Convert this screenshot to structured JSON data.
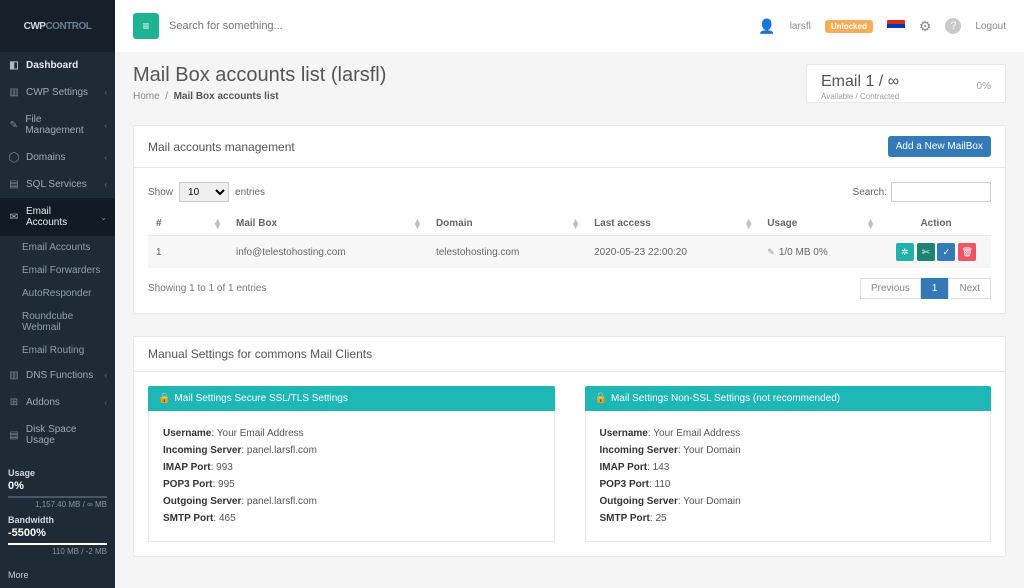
{
  "app": {
    "brand_a": "CWP",
    "brand_b": "CONTROL",
    "search_placeholder": "Search for something...",
    "user_label": "larsfl",
    "unlocked_badge": "Unlocked",
    "logout": "Logout"
  },
  "sidebar": {
    "dashboard": "Dashboard",
    "items": [
      "CWP Settings",
      "File Management",
      "Domains",
      "SQL Services",
      "Email Accounts",
      "DNS Functions",
      "Addons",
      "Disk Space Usage"
    ],
    "email_sub": [
      "Email Accounts",
      "Email Forwarders",
      "AutoResponder",
      "Roundcube Webmail",
      "Email Routing"
    ],
    "stats": {
      "usage_label": "Usage",
      "usage_val": "0%",
      "usage_fine": "1,157.40 MB / ∞ MB",
      "bw_label": "Bandwidth",
      "bw_val": "-5500%",
      "bw_fine": "110 MB / -2 MB"
    },
    "more": "More"
  },
  "page": {
    "title": "Mail Box accounts list (larsfl)",
    "crumb_home": "Home",
    "crumb_curr": "Mail Box accounts list",
    "quota_title": "Email 1 / ∞",
    "quota_sub": "Available / Contracted",
    "quota_pct": "0%"
  },
  "panel": {
    "title": "Mail accounts management",
    "add_btn": "Add a New MailBox",
    "show_label": "Show",
    "entries_label": "entries",
    "search_label": "Search:",
    "info": "Showing 1 to 1 of 1 entries",
    "prev": "Previous",
    "page1": "1",
    "next": "Next"
  },
  "cols": {
    "num": "#",
    "mailbox": "Mail Box",
    "domain": "Domain",
    "last": "Last access",
    "usage": "Usage",
    "action": "Action"
  },
  "rows": {
    "0": {
      "num": "1",
      "mailbox": "info@telestohosting.com",
      "domain": "telestohosting.com",
      "last": "2020-05-23 22:00:20",
      "usage": "1/0 MB 0%"
    }
  },
  "ms": {
    "title": "Manual Settings for commons Mail Clients",
    "secure_h": "Mail Settings Secure SSL/TLS Settings",
    "plain_h": "Mail Settings Non-SSL Settings (not recommended)",
    "ul": "Username",
    "uv": "Your Email Address",
    "isl": "Incoming Server",
    "isv_secure": "panel.larsfl.com",
    "isv_plain": "Your Domain",
    "imapl": "IMAP Port",
    "imapv_secure": "993",
    "imapv_plain": "143",
    "pop3l": "POP3 Port",
    "pop3v_secure": "995",
    "pop3v_plain": "110",
    "osl": "Outgoing Server",
    "osv_secure": "panel.larsfl.com",
    "osv_plain": "Your Domain",
    "smtpl": "SMTP Port",
    "smtpv_secure": "465",
    "smtpv_plain": "25"
  }
}
